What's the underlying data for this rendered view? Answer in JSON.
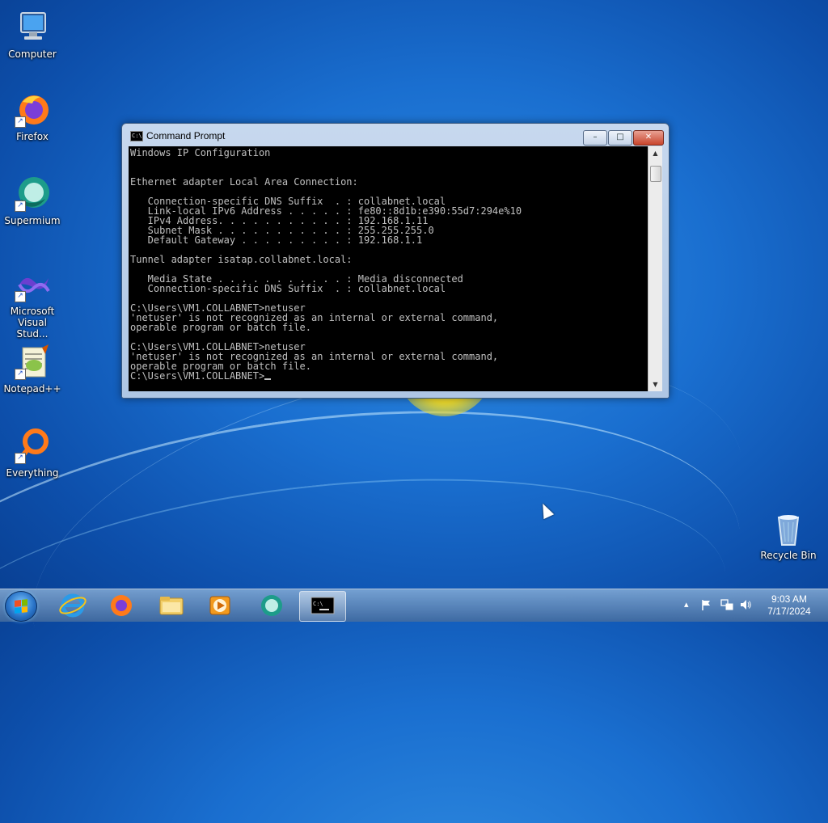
{
  "desktop": {
    "icons": [
      {
        "label": "Computer",
        "icon": "computer-icon"
      },
      {
        "label": "Firefox",
        "icon": "firefox-icon"
      },
      {
        "label": "Supermium",
        "icon": "supermium-icon"
      },
      {
        "label": "Microsoft Visual Stud...",
        "icon": "visual-studio-icon"
      },
      {
        "label": "Notepad++",
        "icon": "notepad-plus-plus-icon"
      },
      {
        "label": "Everything",
        "icon": "everything-icon"
      },
      {
        "label": "Recycle Bin",
        "icon": "recycle-bin-icon"
      }
    ]
  },
  "cmd_window": {
    "title": "Command Prompt",
    "buttons": {
      "minimize": "–",
      "maximize": "□",
      "close": "✕"
    },
    "console_text": "Windows IP Configuration\n\n\nEthernet adapter Local Area Connection:\n\n   Connection-specific DNS Suffix  . : collabnet.local\n   Link-local IPv6 Address . . . . . : fe80::8d1b:e390:55d7:294e%10\n   IPv4 Address. . . . . . . . . . . : 192.168.1.11\n   Subnet Mask . . . . . . . . . . . : 255.255.255.0\n   Default Gateway . . . . . . . . . : 192.168.1.1\n\nTunnel adapter isatap.collabnet.local:\n\n   Media State . . . . . . . . . . . : Media disconnected\n   Connection-specific DNS Suffix  . : collabnet.local\n\nC:\\Users\\VM1.COLLABNET>netuser\n'netuser' is not recognized as an internal or external command,\noperable program or batch file.\n\nC:\\Users\\VM1.COLLABNET>netuser\n'netuser' is not recognized as an internal or external command,\noperable program or batch file.\n",
    "prompt": "C:\\Users\\VM1.COLLABNET>"
  },
  "taskbar": {
    "pinned": [
      {
        "name": "internet-explorer-icon"
      },
      {
        "name": "firefox-icon"
      },
      {
        "name": "file-explorer-icon"
      },
      {
        "name": "media-player-icon"
      },
      {
        "name": "supermium-icon"
      },
      {
        "name": "command-prompt-icon",
        "active": true
      }
    ],
    "tray": {
      "show_hidden": "▴",
      "icons": [
        "action-center-flag-icon",
        "network-icon",
        "volume-icon"
      ]
    },
    "clock": {
      "time": "9:03 AM",
      "date": "7/17/2024"
    }
  },
  "colors": {
    "console_bg": "#000000",
    "console_text": "#c0c0c0",
    "close_button": "#c9452c",
    "wallpaper": "#1a6fd0"
  }
}
